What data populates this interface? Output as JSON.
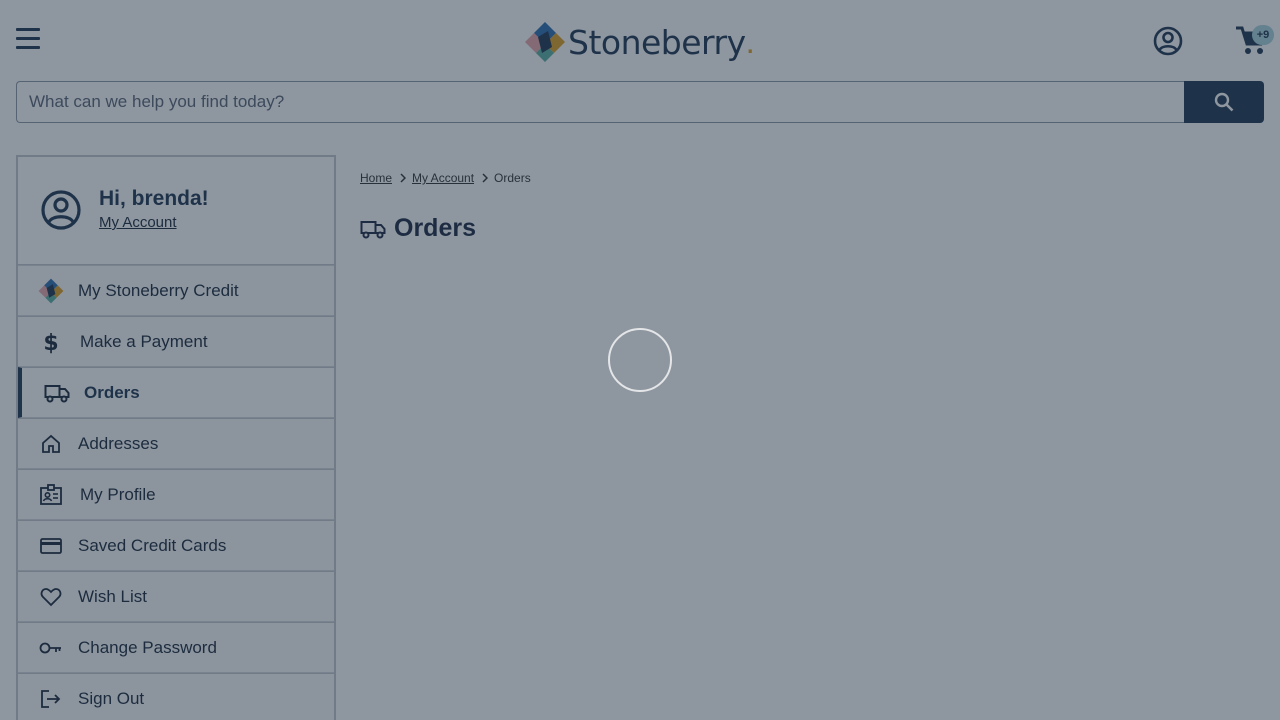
{
  "header": {
    "logo_text": "Stoneberry",
    "logo_dot": ".",
    "cart_badge": "+9",
    "icons": {
      "menu": "hamburger-menu-icon",
      "account": "account-circle-icon",
      "cart": "shopping-cart-icon"
    }
  },
  "search": {
    "placeholder": "What can we help you find today?",
    "value": "",
    "button_icon": "search-icon"
  },
  "sidebar": {
    "greeting": "Hi, brenda!",
    "account_link": "My Account",
    "items": [
      {
        "label": "My Stoneberry Credit",
        "icon": "stoneberry-logo-icon"
      },
      {
        "label": "Make a Payment",
        "icon": "dollar-icon"
      },
      {
        "label": "Orders",
        "icon": "truck-icon",
        "active": true
      },
      {
        "label": "Addresses",
        "icon": "home-icon"
      },
      {
        "label": "My Profile",
        "icon": "id-badge-icon"
      },
      {
        "label": "Saved Credit Cards",
        "icon": "credit-card-icon"
      },
      {
        "label": "Wish List",
        "icon": "heart-icon"
      },
      {
        "label": "Change Password",
        "icon": "key-icon"
      },
      {
        "label": "Sign Out",
        "icon": "sign-out-icon"
      }
    ]
  },
  "breadcrumb": {
    "items": [
      "Home",
      "My Account",
      "Orders"
    ]
  },
  "page": {
    "title": "Orders",
    "title_icon": "truck-icon"
  },
  "overlay": {
    "loading": true
  },
  "colors": {
    "brand_navy": "#1f3650",
    "badge": "#a8d5db"
  }
}
